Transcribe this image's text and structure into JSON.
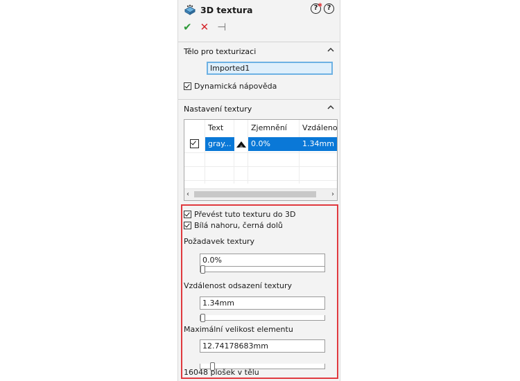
{
  "panel": {
    "title": "3D textura",
    "title_icon": "texture-cube-icon",
    "help_icons": [
      "help-tips-icon",
      "help-icon"
    ],
    "actions": {
      "ok": "✔",
      "cancel": "✕",
      "pin": "⊣"
    }
  },
  "body_section": {
    "title": "Tělo pro texturizaci",
    "selected_body": "Imported1",
    "dynamic_help_label": "Dynamická nápověda",
    "dynamic_help_checked": true
  },
  "texture_settings": {
    "title": "Nastavení textury",
    "table": {
      "columns": [
        "Text",
        "Zjemnění",
        "Vzdálenos"
      ],
      "rows": [
        {
          "checked": true,
          "text": "gray...",
          "refinement": "0.0%",
          "offset": "1.34mm",
          "selected": true
        }
      ]
    },
    "convert_label": "Převést tuto texturu do 3D",
    "convert_checked": true,
    "white_up_label": "Bílá nahoru, černá dolů",
    "white_up_checked": true,
    "refinement_label": "Požadavek textury",
    "refinement_value": "0.0%",
    "refinement_slider": 0.0,
    "offset_label": "Vzdálenost odsazení textury",
    "offset_value": "1.34mm",
    "offset_slider": 0.0,
    "max_element_label": "Maximální velikost elementu",
    "max_element_value": "12.74178683mm",
    "max_element_slider": 0.08,
    "faces_count": "16048 plošek v tělu"
  },
  "colors": {
    "accent_blue": "#0a78d7",
    "highlight_box": "#e0393e",
    "ok_green": "#2e9a3a",
    "cancel_red": "#d4252b"
  }
}
